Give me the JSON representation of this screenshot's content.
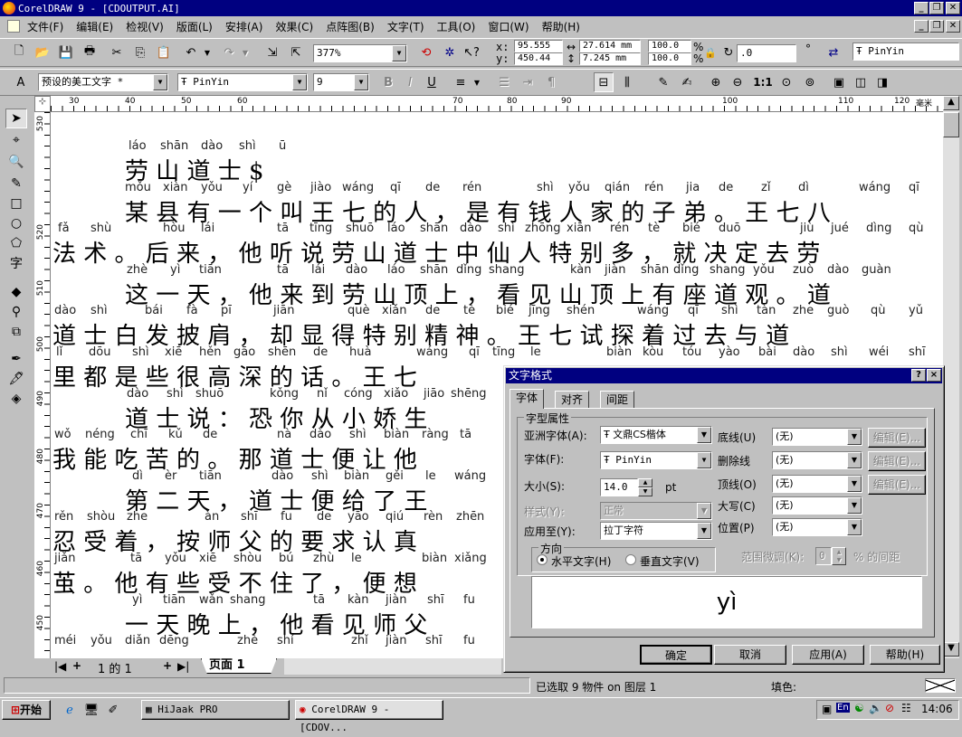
{
  "window": {
    "title": "CorelDRAW 9 - [CDOUTPUT.AI]"
  },
  "menu": [
    "文件(F)",
    "编辑(E)",
    "检视(V)",
    "版面(L)",
    "安排(A)",
    "效果(C)",
    "点阵图(B)",
    "文字(T)",
    "工具(O)",
    "窗口(W)",
    "帮助(H)"
  ],
  "toolbar": {
    "zoom": "377%",
    "x_label": "x:",
    "y_label": "y:",
    "x_value": "95.555",
    "y_value": "450.44",
    "w_value": "27.614 mm",
    "h_value": "7.245 mm",
    "scale_w": "100.0",
    "scale_h": "100.0",
    "pct": "%",
    "angle": ".0",
    "deg": "°",
    "font_name": "PinYin"
  },
  "propbar": {
    "style": "预设的美工文字 *",
    "font": "PinYin",
    "size": "9"
  },
  "ruler": {
    "h_ticks": [
      "30",
      "40",
      "50",
      "60",
      "70",
      "80",
      "90",
      "100",
      "110",
      "120"
    ],
    "unit": "毫米",
    "v_ticks": [
      "530",
      "520",
      "510",
      "500",
      "490",
      "480",
      "470",
      "460",
      "450"
    ]
  },
  "doc_lines": [
    {
      "y": 0,
      "items": [
        [
          "láo",
          86
        ],
        [
          "shān",
          121
        ],
        [
          "dào",
          166
        ],
        [
          "shì",
          208
        ],
        [
          "ū",
          252
        ]
      ],
      "hz": "劳 山 道 士 $",
      "hzx": 82
    },
    {
      "y": 1,
      "items": [
        [
          "mǒu",
          82
        ],
        [
          "xiàn",
          124
        ],
        [
          "yǒu",
          166
        ],
        [
          "yí",
          212
        ],
        [
          "gè",
          250
        ],
        [
          "jiào",
          287
        ],
        [
          "wáng",
          322
        ],
        [
          "qī",
          375
        ],
        [
          "de",
          414
        ],
        [
          "rén",
          455
        ],
        [
          "shì",
          537
        ],
        [
          "yǒu",
          572
        ],
        [
          "qián",
          612
        ],
        [
          "rén",
          656
        ],
        [
          "jia",
          702
        ],
        [
          "de",
          738
        ],
        [
          "zǐ",
          785
        ],
        [
          "dì",
          826
        ],
        [
          "wáng",
          893
        ],
        [
          "qī",
          948
        ]
      ],
      "hz": "某 县 有 一 个 叫 王 七 的 人 ， 是 有 钱 人 家 的 子 弟 。 王 七 八",
      "hzx": 82
    },
    {
      "y": 2,
      "items": [
        [
          "fǎ",
          8
        ],
        [
          "shù",
          44
        ],
        [
          "hòu",
          124
        ],
        [
          "lái",
          166
        ],
        [
          "tā",
          250
        ],
        [
          "tīng",
          286
        ],
        [
          "shuō",
          326
        ],
        [
          "láo",
          372
        ],
        [
          "shān",
          408
        ],
        [
          "dào",
          452
        ],
        [
          "shì",
          494
        ],
        [
          "zhōng",
          524
        ],
        [
          "xiān",
          570
        ],
        [
          "rén",
          618
        ],
        [
          "tè",
          660
        ],
        [
          "bié",
          698
        ],
        [
          "duō",
          738
        ],
        [
          "jiù",
          828
        ],
        [
          "jué",
          862
        ],
        [
          "dìng",
          901
        ],
        [
          "qù",
          948
        ]
      ],
      "hz": "法 术 。 后 来 ， 他 听 说 劳 山 道 士 中 仙 人 特 别 多 ， 就 决 定 去 劳",
      "hzx": 2
    },
    {
      "y": 3,
      "items": [
        [
          "zhè",
          84
        ],
        [
          "yì",
          132
        ],
        [
          "tiān",
          164
        ],
        [
          "tā",
          250
        ],
        [
          "lái",
          288
        ],
        [
          "dào",
          326
        ],
        [
          "láo",
          372
        ],
        [
          "shān",
          408
        ],
        [
          "dǐng",
          448
        ],
        [
          "shang",
          484
        ],
        [
          "kàn",
          574
        ],
        [
          "jiàn",
          612
        ],
        [
          "shān",
          652
        ],
        [
          "dǐng",
          688
        ],
        [
          "shang",
          728
        ],
        [
          "yǒu",
          776
        ],
        [
          "zuò",
          820
        ],
        [
          "dào",
          858
        ],
        [
          "guàn",
          896
        ]
      ],
      "hz": "这 一 天 ， 他 来 到 劳 山 顶 上 ， 看 见 山 顶 上 有 座 道 观 。 道",
      "hzx": 82
    },
    {
      "y": 4,
      "items": [
        [
          "dào",
          4
        ],
        [
          "shì",
          44
        ],
        [
          "bái",
          104
        ],
        [
          "fà",
          150
        ],
        [
          "pī",
          188
        ],
        [
          "jiān",
          246
        ],
        [
          "què",
          328
        ],
        [
          "xiǎn",
          366
        ],
        [
          "de",
          414
        ],
        [
          "tè",
          456
        ],
        [
          "bié",
          492
        ],
        [
          "jīng",
          528
        ],
        [
          "shén",
          570
        ],
        [
          "wáng",
          648
        ],
        [
          "qī",
          704
        ],
        [
          "shì",
          741
        ],
        [
          "tàn",
          780
        ],
        [
          "zhe",
          820
        ],
        [
          "guò",
          858
        ],
        [
          "qù",
          906
        ],
        [
          "yǔ",
          948
        ]
      ],
      "hz": "道 士 白 发 披 肩 ， 却 显 得 特 别 精 神 。 王 七 试 探 着 过 去 与 道",
      "hzx": 2
    },
    {
      "y": 5,
      "items": [
        [
          "lǐ",
          6
        ],
        [
          "dōu",
          42
        ],
        [
          "shì",
          90
        ],
        [
          "xiē",
          126
        ],
        [
          "hěn",
          164
        ],
        [
          "gāo",
          202
        ],
        [
          "shēn",
          240
        ],
        [
          "de",
          290
        ],
        [
          "huà",
          330
        ],
        [
          "wáng",
          404
        ],
        [
          "qī",
          462
        ],
        [
          "tīng",
          488
        ],
        [
          "le",
          530
        ],
        [
          "biàn",
          614
        ],
        [
          "kòu",
          654
        ],
        [
          "tóu",
          698
        ],
        [
          "yào",
          738
        ],
        [
          "bài",
          782
        ],
        [
          "dào",
          820
        ],
        [
          "shì",
          862
        ],
        [
          "wéi",
          904
        ],
        [
          "shī",
          948
        ]
      ],
      "hz": "里 都 是 些 很 高 深 的 话 。 王 七",
      "hzx": 2
    },
    {
      "y": 6,
      "items": [
        [
          "dào",
          84
        ],
        [
          "shì",
          128
        ],
        [
          "shuō",
          160
        ],
        [
          "kǒng",
          242
        ],
        [
          "nǐ",
          294
        ],
        [
          "cóng",
          324
        ],
        [
          "xiǎo",
          368
        ],
        [
          "jiāo",
          412
        ],
        [
          "shēng",
          442
        ]
      ],
      "hz": "道 士 说 ： 恐 你 从 小 娇 生",
      "hzx": 82
    },
    {
      "y": 7,
      "items": [
        [
          "wǒ",
          4
        ],
        [
          "néng",
          38
        ],
        [
          "chī",
          88
        ],
        [
          "kǔ",
          130
        ],
        [
          "de",
          168
        ],
        [
          "nà",
          250
        ],
        [
          "dào",
          286
        ],
        [
          "shì",
          330
        ],
        [
          "biàn",
          368
        ],
        [
          "ràng",
          410
        ],
        [
          "tā",
          452
        ]
      ],
      "hz": "我 能 吃 苦 的 。 那 道 士 便 让 他",
      "hzx": 2
    },
    {
      "y": 8,
      "items": [
        [
          "dì",
          90
        ],
        [
          "èr",
          126
        ],
        [
          "tiān",
          164
        ],
        [
          "dào",
          244
        ],
        [
          "shì",
          288
        ],
        [
          "biàn",
          324
        ],
        [
          "gěi",
          370
        ],
        [
          "le",
          414
        ],
        [
          "wáng",
          446
        ]
      ],
      "hz": "第 二 天 ， 道 士 便 给 了 王",
      "hzx": 82
    },
    {
      "y": 9,
      "items": [
        [
          "rěn",
          4
        ],
        [
          "shòu",
          40
        ],
        [
          "zhe",
          84
        ],
        [
          "àn",
          170
        ],
        [
          "shī",
          210
        ],
        [
          "fu",
          254
        ],
        [
          "de",
          294
        ],
        [
          "yāo",
          328
        ],
        [
          "qiú",
          370
        ],
        [
          "rèn",
          412
        ],
        [
          "zhēn",
          448
        ]
      ],
      "hz": "忍 受 着 ， 按 师 父 的 要 求 认 真",
      "hzx": 2
    },
    {
      "y": 10,
      "items": [
        [
          "jiǎn",
          4
        ],
        [
          "tā",
          88
        ],
        [
          "yǒu",
          126
        ],
        [
          "xiē",
          164
        ],
        [
          "shòu",
          202
        ],
        [
          "bú",
          252
        ],
        [
          "zhù",
          290
        ],
        [
          "le",
          332
        ],
        [
          "biàn",
          410
        ],
        [
          "xiǎng",
          446
        ]
      ],
      "hz": "茧 。 他 有 些 受 不 住 了 ， 便 想",
      "hzx": 2
    },
    {
      "y": 11,
      "items": [
        [
          "yì",
          90
        ],
        [
          "tiān",
          124
        ],
        [
          "wǎn",
          164
        ],
        [
          "shang",
          198
        ],
        [
          "tā",
          290
        ],
        [
          "kàn",
          328
        ],
        [
          "jiàn",
          370
        ],
        [
          "shī",
          416
        ],
        [
          "fu",
          456
        ]
      ],
      "hz": "一 天 晚 上 ， 他 看 见 师 父",
      "hzx": 82
    },
    {
      "y": 12,
      "items": [
        [
          "méi",
          4
        ],
        [
          "yǒu",
          44
        ],
        [
          "diǎn",
          82
        ],
        [
          "dēng",
          120
        ],
        [
          "zhè",
          206
        ],
        [
          "shí",
          250
        ],
        [
          "zhǐ",
          332
        ],
        [
          "jiàn",
          370
        ],
        [
          "shī",
          414
        ],
        [
          "fu",
          456
        ]
      ],
      "hz": "",
      "hzx": 2
    }
  ],
  "hscroll": {
    "page_of": "1 的 1",
    "page_tab": "页面 1"
  },
  "status": {
    "selection": "已选取 9 物件 on 图层 1",
    "fill_label": "填色:"
  },
  "dialog": {
    "title": "文字格式",
    "help": "?",
    "close": "×",
    "tabs": [
      "字体",
      "对齐",
      "间距"
    ],
    "group_title": "字型属性",
    "asian_font_label": "亚洲字体(A):",
    "asian_font": "文鼎CS楷体",
    "font_label": "字体(F):",
    "font": "PinYin",
    "size_label": "大小(S):",
    "size": "14.0",
    "size_unit": "pt",
    "style_label": "样式(Y):",
    "style": "正常",
    "apply_label": "应用至(Y):",
    "apply": "拉丁字符",
    "underline_label": "底线(U)",
    "strike_label": "删除线",
    "overline_label": "顶线(O)",
    "caps_label": "大写(C)",
    "pos_label": "位置(P)",
    "none": "(无)",
    "edit": "编辑(E)...",
    "range_label": "范围微调(K):",
    "range_value": "0",
    "range_unit": "% 的间距",
    "dir_title": "方向",
    "horiz": "水平文字(H)",
    "vert": "垂直文字(V)",
    "preview": "yì",
    "ok": "确定",
    "cancel": "取消",
    "apply_btn": "应用(A)",
    "help_btn": "帮助(H)"
  },
  "taskbar": {
    "start": "开始",
    "tasks": [
      "HiJaak PRO",
      "CorelDRAW 9 - [CDOV..."
    ],
    "clock": "14:06",
    "tray_en": "En"
  }
}
